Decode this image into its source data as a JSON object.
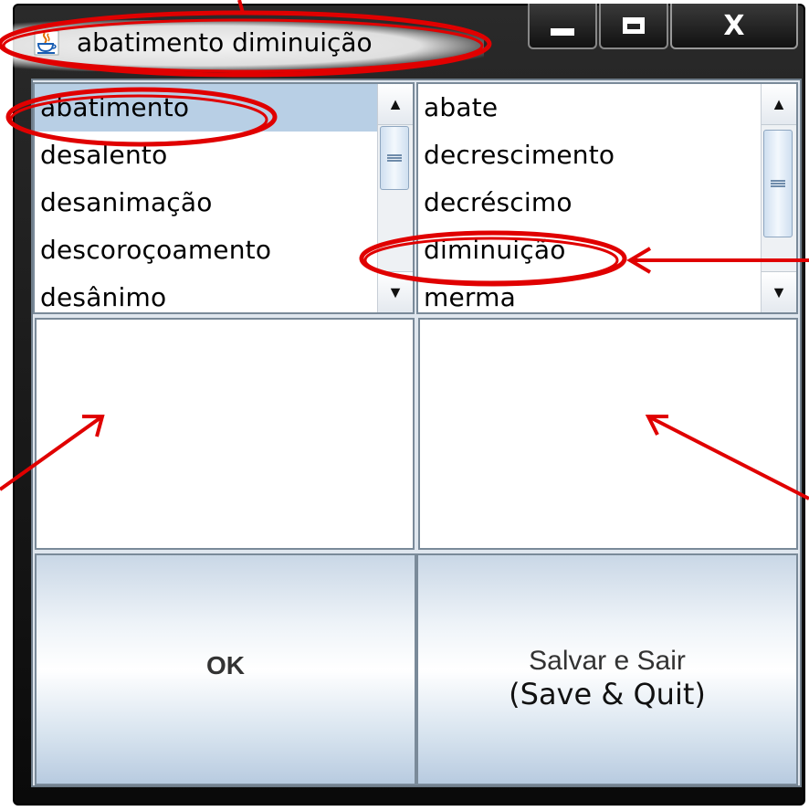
{
  "window": {
    "title": "abatimento diminuição",
    "icon": "java-cup-icon",
    "controls": {
      "minimize": "minimize-icon",
      "maximize": "maximize-icon",
      "close": "X"
    }
  },
  "left_list": {
    "items": [
      "abatimento",
      "desalento",
      "desanimação",
      "descoroçoamento",
      "desânimo"
    ],
    "selected": "abatimento"
  },
  "right_list": {
    "items": [
      "abate",
      "decrescimento",
      "decréscimo",
      "diminuição",
      "merma"
    ],
    "highlighted": "diminuição"
  },
  "buttons": {
    "ok": "OK",
    "save": "Salvar e Sair",
    "save_translation": "(Save & Quit)"
  },
  "annotation_color": "#e00000"
}
